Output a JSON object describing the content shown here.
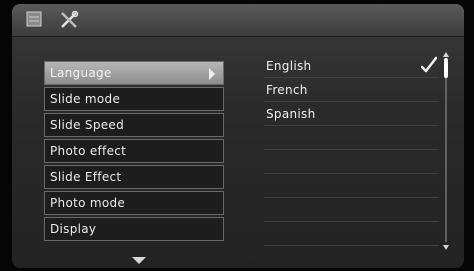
{
  "toolbar": {
    "icons": [
      "settings-icon",
      "tools-icon"
    ]
  },
  "menu": {
    "items": [
      {
        "label": "Language",
        "selected": true
      },
      {
        "label": "Slide mode",
        "selected": false
      },
      {
        "label": "Slide Speed",
        "selected": false
      },
      {
        "label": "Photo effect",
        "selected": false
      },
      {
        "label": "Slide Effect",
        "selected": false
      },
      {
        "label": "Photo mode",
        "selected": false
      },
      {
        "label": "Display",
        "selected": false
      }
    ]
  },
  "language_options": [
    {
      "label": "English",
      "checked": true
    },
    {
      "label": "French",
      "checked": false
    },
    {
      "label": "Spanish",
      "checked": false
    }
  ],
  "colors": {
    "selected_bg": "#a6a6a6",
    "item_bg": "#1d1d1d",
    "border": "#6a6a6a",
    "text": "#ececec"
  }
}
